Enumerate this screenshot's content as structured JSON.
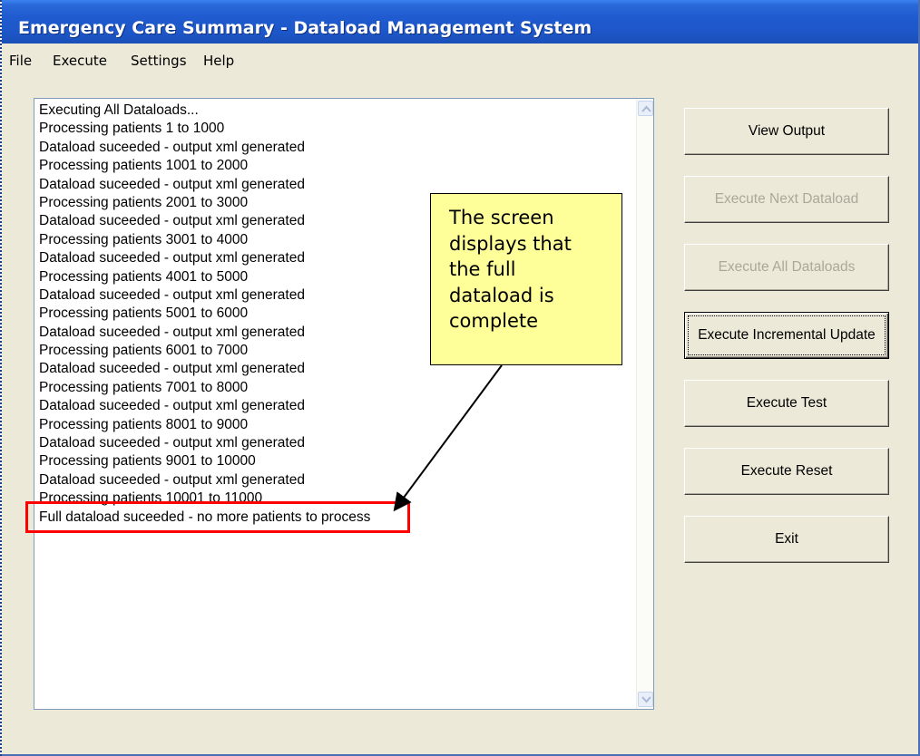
{
  "window": {
    "title": "Emergency Care Summary - Dataload Management System"
  },
  "menu": [
    "File",
    "Execute",
    "Settings",
    "Help"
  ],
  "log": {
    "lines": [
      "Executing All Dataloads...",
      "Processing patients 1 to 1000",
      "Dataload suceeded - output xml generated",
      "Processing patients 1001 to 2000",
      "Dataload suceeded - output xml generated",
      "Processing patients 2001 to 3000",
      "Dataload suceeded - output xml generated",
      "Processing patients 3001 to 4000",
      "Dataload suceeded - output xml generated",
      "Processing patients 4001 to 5000",
      "Dataload suceeded - output xml generated",
      "Processing patients 5001 to 6000",
      "Dataload suceeded - output xml generated",
      "Processing patients 6001 to 7000",
      "Dataload suceeded - output xml generated",
      "Processing patients 7001 to 8000",
      "Dataload suceeded - output xml generated",
      "Processing patients 8001 to 9000",
      "Dataload suceeded - output xml generated",
      "Processing patients 9001 to 10000",
      "Dataload suceeded - output xml generated",
      "Processing patients 10001 to 11000",
      "Full dataload suceeded - no more patients to process"
    ]
  },
  "buttons": {
    "view_output": "View Output",
    "execute_next": "Execute Next Dataload",
    "execute_all": "Execute All Dataloads",
    "execute_incremental": "Execute Incremental Update",
    "execute_test": "Execute Test",
    "execute_reset": "Execute Reset",
    "exit": "Exit"
  },
  "annotation": {
    "callout_lines": [
      "The screen",
      "displays that",
      "the full",
      "dataload is",
      "complete"
    ],
    "callout_color": "#ffff99",
    "highlight_color": "#ff0000"
  },
  "colors": {
    "titlebar": "#1f5bcf",
    "window_bg": "#ece9d8",
    "disabled_text": "#aca899"
  }
}
